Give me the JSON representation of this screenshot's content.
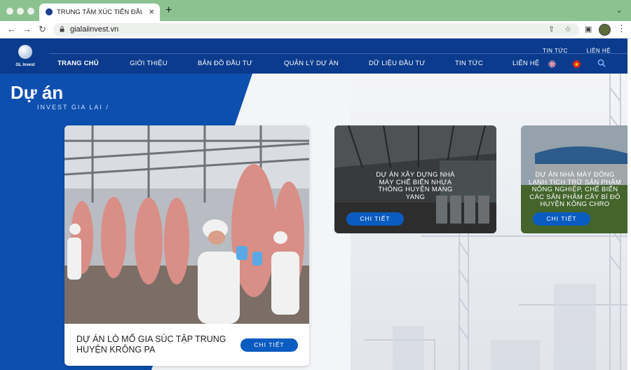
{
  "browser": {
    "tab_title": "TRUNG TÂM XÚC TIẾN ĐẦU TƯ",
    "tab_close": "×",
    "new_tab": "+",
    "tabs_menu": "⌄",
    "back": "←",
    "forward": "→",
    "reload": "↻",
    "url": "gialaiinvest.vn",
    "share_icon": "⇪",
    "star_icon": "☆",
    "sidepanel_icon": "▣",
    "menu_icon": "⋮"
  },
  "site": {
    "logo_text": "GL Invest",
    "top_links": [
      "TIN TỨC",
      "LIÊN HỆ"
    ],
    "nav": [
      {
        "label": "TRANG CHỦ"
      },
      {
        "label": "GIỚI THIỆU"
      },
      {
        "label": "BẢN ĐỒ ĐẦU TƯ"
      },
      {
        "label": "QUẢN LÝ DỰ ÁN"
      },
      {
        "label": "DỮ LIỆU ĐẦU TƯ"
      },
      {
        "label": "TIN TỨC"
      },
      {
        "label": "LIÊN HỆ"
      }
    ],
    "active_nav": "TRANG CHỦ"
  },
  "hero": {
    "title": "Dự án",
    "subtitle": "INVEST GIA LAI /"
  },
  "projects": [
    {
      "title": "DỰ ÁN LÒ MỔ GIA SÚC TẬP TRUNG HUYỆN KRÔNG PA",
      "button": "CHI TIẾT"
    },
    {
      "title_lines": [
        "DỰ ÁN XÂY DỰNG NHÀ",
        "MÁY CHẾ BIẾN NHỰA",
        "THÔNG HUYỆN MANG",
        "YANG"
      ],
      "button": "CHI TIẾT"
    },
    {
      "title_lines": [
        "DỰ ÁN NHÀ MÁY ĐÔNG",
        "LẠNH TÍCH TRỮ SẢN PHẨM",
        "NÔNG NGHIỆP, CHẾ BIẾN",
        "CÁC SẢN PHẨM CÂY BÍ ĐỎ",
        "HUYỆN KÔNG CHRO"
      ],
      "button": "CHI TIẾT"
    }
  ],
  "colors": {
    "browser_chrome": "#8cc28f",
    "header_blue": "#0a3b8c",
    "hero_blue": "#0d4fae",
    "button_blue": "#0b5cc0"
  }
}
